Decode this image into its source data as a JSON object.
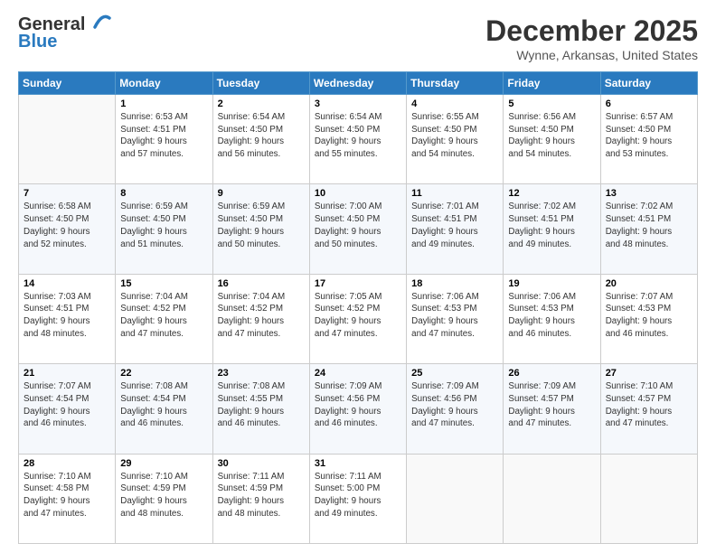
{
  "header": {
    "logo_line1": "General",
    "logo_line2": "Blue",
    "month": "December 2025",
    "location": "Wynne, Arkansas, United States"
  },
  "weekdays": [
    "Sunday",
    "Monday",
    "Tuesday",
    "Wednesday",
    "Thursday",
    "Friday",
    "Saturday"
  ],
  "weeks": [
    [
      {
        "day": "",
        "content": ""
      },
      {
        "day": "1",
        "content": "Sunrise: 6:53 AM\nSunset: 4:51 PM\nDaylight: 9 hours\nand 57 minutes."
      },
      {
        "day": "2",
        "content": "Sunrise: 6:54 AM\nSunset: 4:50 PM\nDaylight: 9 hours\nand 56 minutes."
      },
      {
        "day": "3",
        "content": "Sunrise: 6:54 AM\nSunset: 4:50 PM\nDaylight: 9 hours\nand 55 minutes."
      },
      {
        "day": "4",
        "content": "Sunrise: 6:55 AM\nSunset: 4:50 PM\nDaylight: 9 hours\nand 54 minutes."
      },
      {
        "day": "5",
        "content": "Sunrise: 6:56 AM\nSunset: 4:50 PM\nDaylight: 9 hours\nand 54 minutes."
      },
      {
        "day": "6",
        "content": "Sunrise: 6:57 AM\nSunset: 4:50 PM\nDaylight: 9 hours\nand 53 minutes."
      }
    ],
    [
      {
        "day": "7",
        "content": "Sunrise: 6:58 AM\nSunset: 4:50 PM\nDaylight: 9 hours\nand 52 minutes."
      },
      {
        "day": "8",
        "content": "Sunrise: 6:59 AM\nSunset: 4:50 PM\nDaylight: 9 hours\nand 51 minutes."
      },
      {
        "day": "9",
        "content": "Sunrise: 6:59 AM\nSunset: 4:50 PM\nDaylight: 9 hours\nand 50 minutes."
      },
      {
        "day": "10",
        "content": "Sunrise: 7:00 AM\nSunset: 4:50 PM\nDaylight: 9 hours\nand 50 minutes."
      },
      {
        "day": "11",
        "content": "Sunrise: 7:01 AM\nSunset: 4:51 PM\nDaylight: 9 hours\nand 49 minutes."
      },
      {
        "day": "12",
        "content": "Sunrise: 7:02 AM\nSunset: 4:51 PM\nDaylight: 9 hours\nand 49 minutes."
      },
      {
        "day": "13",
        "content": "Sunrise: 7:02 AM\nSunset: 4:51 PM\nDaylight: 9 hours\nand 48 minutes."
      }
    ],
    [
      {
        "day": "14",
        "content": "Sunrise: 7:03 AM\nSunset: 4:51 PM\nDaylight: 9 hours\nand 48 minutes."
      },
      {
        "day": "15",
        "content": "Sunrise: 7:04 AM\nSunset: 4:52 PM\nDaylight: 9 hours\nand 47 minutes."
      },
      {
        "day": "16",
        "content": "Sunrise: 7:04 AM\nSunset: 4:52 PM\nDaylight: 9 hours\nand 47 minutes."
      },
      {
        "day": "17",
        "content": "Sunrise: 7:05 AM\nSunset: 4:52 PM\nDaylight: 9 hours\nand 47 minutes."
      },
      {
        "day": "18",
        "content": "Sunrise: 7:06 AM\nSunset: 4:53 PM\nDaylight: 9 hours\nand 47 minutes."
      },
      {
        "day": "19",
        "content": "Sunrise: 7:06 AM\nSunset: 4:53 PM\nDaylight: 9 hours\nand 46 minutes."
      },
      {
        "day": "20",
        "content": "Sunrise: 7:07 AM\nSunset: 4:53 PM\nDaylight: 9 hours\nand 46 minutes."
      }
    ],
    [
      {
        "day": "21",
        "content": "Sunrise: 7:07 AM\nSunset: 4:54 PM\nDaylight: 9 hours\nand 46 minutes."
      },
      {
        "day": "22",
        "content": "Sunrise: 7:08 AM\nSunset: 4:54 PM\nDaylight: 9 hours\nand 46 minutes."
      },
      {
        "day": "23",
        "content": "Sunrise: 7:08 AM\nSunset: 4:55 PM\nDaylight: 9 hours\nand 46 minutes."
      },
      {
        "day": "24",
        "content": "Sunrise: 7:09 AM\nSunset: 4:56 PM\nDaylight: 9 hours\nand 46 minutes."
      },
      {
        "day": "25",
        "content": "Sunrise: 7:09 AM\nSunset: 4:56 PM\nDaylight: 9 hours\nand 47 minutes."
      },
      {
        "day": "26",
        "content": "Sunrise: 7:09 AM\nSunset: 4:57 PM\nDaylight: 9 hours\nand 47 minutes."
      },
      {
        "day": "27",
        "content": "Sunrise: 7:10 AM\nSunset: 4:57 PM\nDaylight: 9 hours\nand 47 minutes."
      }
    ],
    [
      {
        "day": "28",
        "content": "Sunrise: 7:10 AM\nSunset: 4:58 PM\nDaylight: 9 hours\nand 47 minutes."
      },
      {
        "day": "29",
        "content": "Sunrise: 7:10 AM\nSunset: 4:59 PM\nDaylight: 9 hours\nand 48 minutes."
      },
      {
        "day": "30",
        "content": "Sunrise: 7:11 AM\nSunset: 4:59 PM\nDaylight: 9 hours\nand 48 minutes."
      },
      {
        "day": "31",
        "content": "Sunrise: 7:11 AM\nSunset: 5:00 PM\nDaylight: 9 hours\nand 49 minutes."
      },
      {
        "day": "",
        "content": ""
      },
      {
        "day": "",
        "content": ""
      },
      {
        "day": "",
        "content": ""
      }
    ]
  ]
}
